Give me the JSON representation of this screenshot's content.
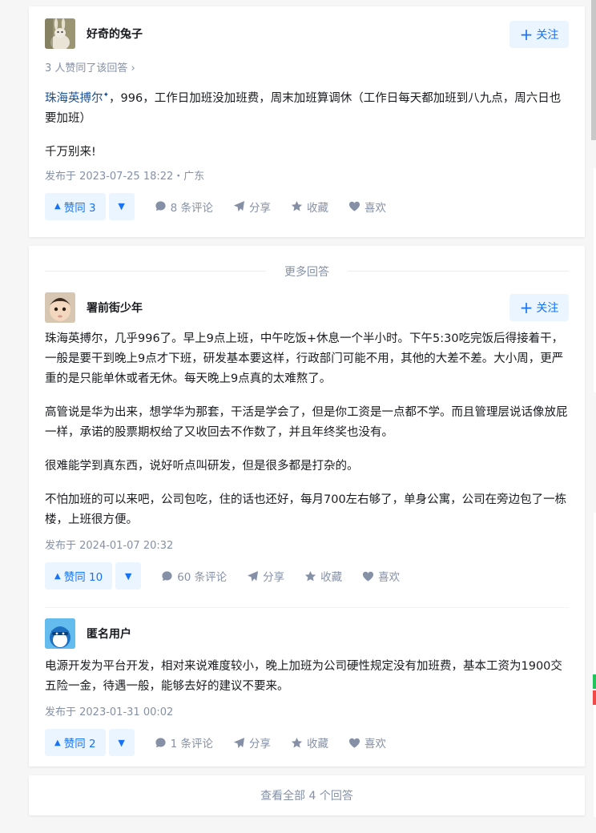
{
  "top_answer": {
    "author": "好奇的兔子",
    "follow_label": "关注",
    "voters_text": "3 人赞同了该回答 ›",
    "content": {
      "link_text": "珠海英搏尔",
      "line1_rest": "，996，工作日加班没加班费，周末加班算调休（工作日每天都加班到八九点，周六日也要加班）",
      "line2": "千万别来!"
    },
    "time": "发布于 2023-07-25 18:22・广东",
    "vote_label": "赞同 3",
    "comments": "8 条评论",
    "share": "分享",
    "collect": "收藏",
    "like": "喜欢"
  },
  "more_answers": {
    "title": "更多回答",
    "answers": [
      {
        "author": "署前街少年",
        "follow_label": "关注",
        "paragraphs": [
          "珠海英搏尔，几乎996了。早上9点上班，中午吃饭+休息一个半小时。下午5:30吃完饭后得接着干，一般是要干到晚上9点才下班，研发基本要这样，行政部门可能不用，其他的大差不差。大小周，更严重的是只能单休或者无休。每天晚上9点真的太难熬了。",
          "高管说是华为出来，想学华为那套，干活是学会了，但是你工资是一点都不学。而且管理层说话像放屁一样，承诺的股票期权给了又收回去不作数了，并且年终奖也没有。",
          "很难能学到真东西，说好听点叫研发，但是很多都是打杂的。",
          "不怕加班的可以来吧，公司包吃，住的话也还好，每月700左右够了，单身公寓，公司在旁边包了一栋楼，上班很方便。"
        ],
        "time": "发布于 2024-01-07 20:32",
        "vote_label": "赞同 10",
        "comments": "60 条评论",
        "share": "分享",
        "collect": "收藏",
        "like": "喜欢"
      },
      {
        "author": "匿名用户",
        "paragraphs": [
          "电源开发为平台开发，相对来说难度较小，晚上加班为公司硬性规定没有加班费，基本工资为1900交五险一金，待遇一般，能够去好的建议不要来。"
        ],
        "time": "发布于 2023-01-31 00:02",
        "vote_label": "赞同 2",
        "comments": "1 条评论",
        "share": "分享",
        "collect": "收藏",
        "like": "喜欢"
      }
    ]
  },
  "view_all_label": "查看全部 4 个回答"
}
